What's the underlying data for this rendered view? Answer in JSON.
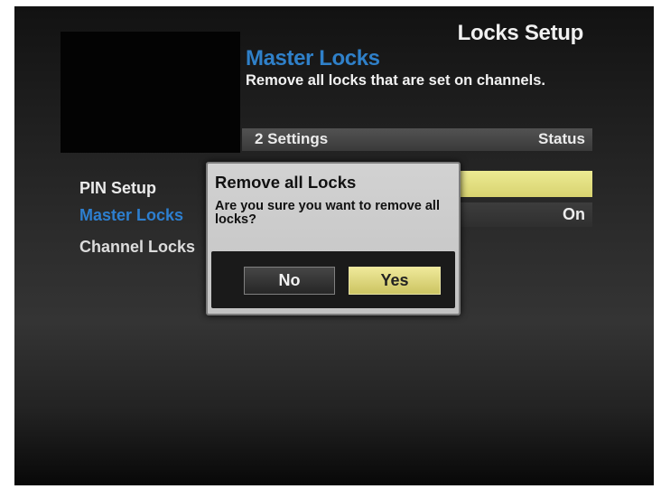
{
  "screen": {
    "title": "Locks Setup"
  },
  "section": {
    "title": "Master Locks",
    "description": "Remove all locks that are set on channels."
  },
  "list_header": {
    "count_label": "2 Settings",
    "status_label": "Status"
  },
  "menu": {
    "items": [
      {
        "label": "PIN Setup"
      },
      {
        "label": "Master Locks",
        "state": "selected"
      },
      {
        "label": "Channel Locks"
      }
    ]
  },
  "rows": {
    "master_locks_status": "On"
  },
  "dialog": {
    "title": "Remove all Locks",
    "message": "Are you sure you want to remove all locks?",
    "no_label": "No",
    "yes_label": "Yes",
    "focused_button": "Yes"
  },
  "colors": {
    "accent_blue": "#2f80c9",
    "highlight_yellow": "#e6e283",
    "dialog_background": "#cbcbcb"
  }
}
